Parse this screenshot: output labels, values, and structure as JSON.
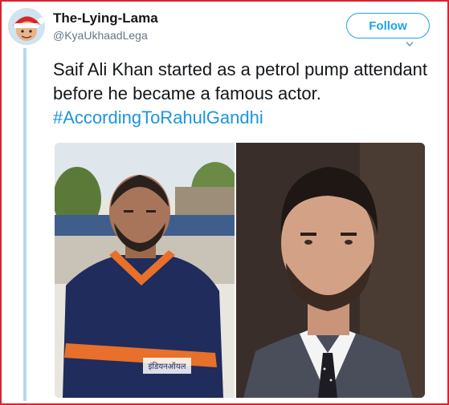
{
  "user": {
    "display_name": "The-Lying-Lama",
    "handle": "@KyaUkhaadLega"
  },
  "follow_label": "Follow",
  "tweet": {
    "text": "Saif Ali Khan started as a petrol pump attendant before he became a famous actor. ",
    "hashtag": "#AccordingToRahulGandhi"
  },
  "media": {
    "left_shirt_text": "इंडियनऑयल"
  },
  "colors": {
    "frame_border": "#d9232e",
    "accent": "#1da1f2",
    "hashtag": "#1b95e0",
    "thread_line": "#b8d7f0"
  },
  "icons": [
    "avatar-santa-hat",
    "chevron-down-icon"
  ]
}
